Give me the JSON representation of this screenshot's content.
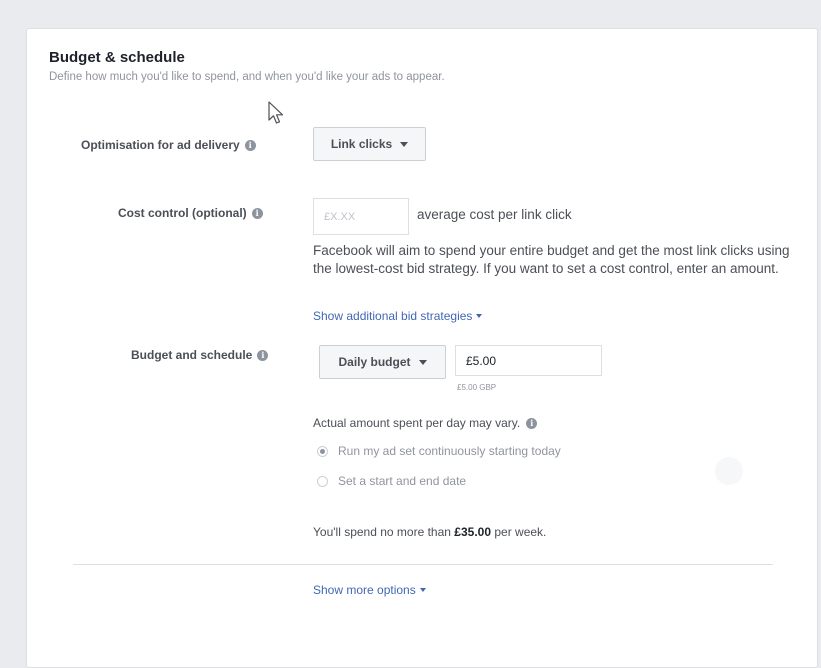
{
  "section": {
    "title": "Budget & schedule",
    "subtitle": "Define how much you'd like to spend, and when you'd like your ads to appear."
  },
  "optimisation": {
    "label": "Optimisation for ad delivery",
    "value": "Link clicks"
  },
  "cost_control": {
    "label": "Cost control (optional)",
    "placeholder": "£X.XX",
    "suffix": "average cost per link click",
    "help": "Facebook will aim to spend your entire budget and get the most link clicks using the lowest-cost bid strategy. If you want to set a cost control, enter an amount.",
    "link": "Show additional bid strategies"
  },
  "budget": {
    "label": "Budget and schedule",
    "type": "Daily budget",
    "amount": "£5.00",
    "currency_note": "£5.00 GBP",
    "variance_note": "Actual amount spent per day may vary.",
    "schedule_options": [
      {
        "label": "Run my ad set continuously starting today",
        "selected": true
      },
      {
        "label": "Set a start and end date",
        "selected": false
      }
    ],
    "weekly_prefix": "You'll spend no more than",
    "weekly_amount": "£35.00",
    "weekly_suffix": "per week."
  },
  "more_options": {
    "label": "Show more options"
  },
  "icons": {
    "info": "info-icon",
    "caret": "caret-down-icon",
    "cursor": "mouse-cursor-icon"
  },
  "colors": {
    "link": "#4267b2",
    "background": "#e9ebee",
    "card": "#ffffff"
  }
}
